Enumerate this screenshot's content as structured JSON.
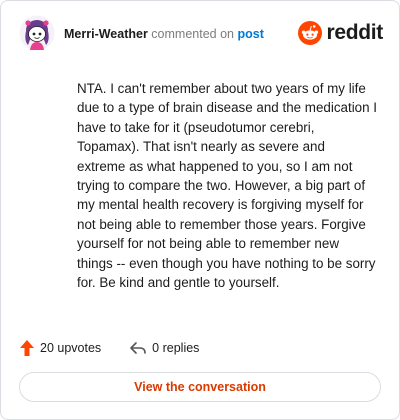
{
  "header": {
    "username": "Merri-Weather",
    "commented_text": " commented on ",
    "post_link": "post",
    "brand_word": "reddit"
  },
  "comment": {
    "body": "NTA. I can't remember about two years of my life due to a type of brain disease and the medication I have to take for it (pseudotumor cerebri, Topamax). That isn't nearly as severe and extreme as what happened to you, so I am not trying to compare the two. However, a big part of my mental health recovery is forgiving myself for not being able to remember those years. Forgive yourself for not being able to remember new things -- even though you have nothing to be sorry for. Be kind and gentle to yourself."
  },
  "actions": {
    "upvotes": "20 upvotes",
    "replies": "0 replies"
  },
  "cta": {
    "label": "View the conversation"
  },
  "icons": {
    "avatar": "snoo-avatar-icon",
    "brand": "reddit-logo-icon",
    "upvote": "upvote-arrow-icon",
    "reply": "reply-arrow-icon"
  },
  "colors": {
    "accent": "#ff4500",
    "link": "#0079d3",
    "cta_text": "#d93a00",
    "avatar_hair": "#6b3b8f"
  }
}
